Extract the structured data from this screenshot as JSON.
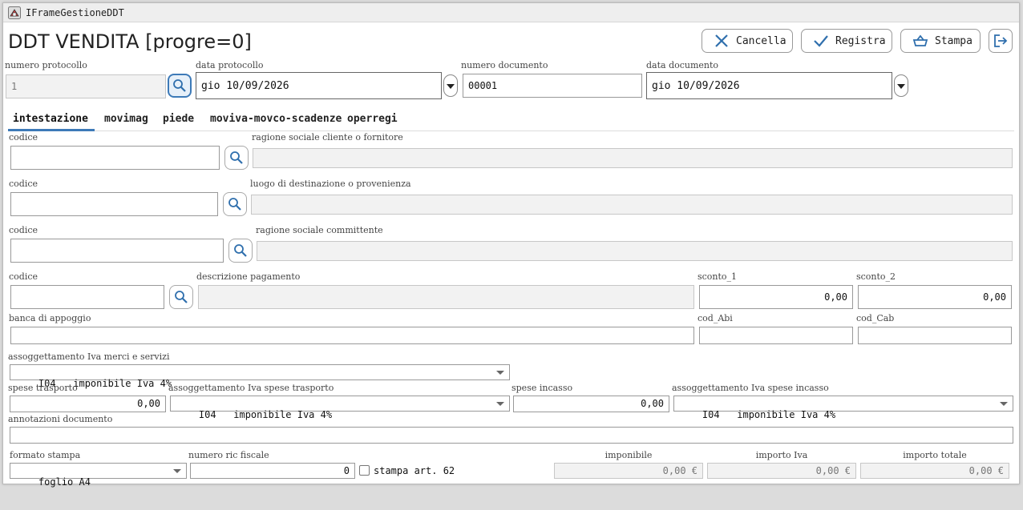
{
  "window": {
    "title": "IFrameGestioneDDT"
  },
  "heading": "DDT VENDITA [progre=0]",
  "toolbar": {
    "cancel_label": "Cancella",
    "save_label": "Registra",
    "print_label": "Stampa"
  },
  "header": {
    "protocol_number_label": "numero protocollo",
    "protocol_number_value": "1",
    "protocol_date_label": "data protocollo",
    "protocol_date_value": "gio 10/09/2026",
    "document_number_label": "numero documento",
    "document_number_value": "00001",
    "document_date_label": "data documento",
    "document_date_value": "gio 10/09/2026"
  },
  "tabs": [
    "intestazione",
    "movimag",
    "piede",
    "moviva-movco-scadenze",
    "operregi"
  ],
  "selected_tab": "intestazione",
  "form": {
    "customer": {
      "code_label": "codice",
      "code_value": "",
      "name_label": "ragione sociale cliente o fornitore",
      "name_value": ""
    },
    "destination": {
      "code_label": "codice",
      "code_value": "",
      "name_label": "luogo di destinazione o provenienza",
      "name_value": ""
    },
    "client": {
      "code_label": "codice",
      "code_value": "",
      "name_label": "ragione sociale committente",
      "name_value": ""
    },
    "payment": {
      "code_label": "codice",
      "code_value": "",
      "desc_label": "descrizione pagamento",
      "desc_value": ""
    },
    "discount1_label": "sconto_1",
    "discount1_value": "0,00",
    "discount2_label": "sconto_2",
    "discount2_value": "0,00",
    "bank_label": "banca di appoggio",
    "bank_value": "",
    "abi_label": "cod_Abi",
    "abi_value": "",
    "cab_label": "cod_Cab",
    "cab_value": "",
    "vat_goods_label": "assoggettamento Iva merci e servizi",
    "vat_goods_value": "I04   imponibile Iva 4%",
    "transport_label": "spese trasporto",
    "transport_value": "0,00",
    "vat_transport_label": "assoggettamento Iva spese trasporto",
    "vat_transport_value": "I04   imponibile Iva 4%",
    "collection_label": "spese incasso",
    "collection_value": "0,00",
    "vat_collection_label": "assoggettamento Iva spese incasso",
    "vat_collection_value": "I04   imponibile Iva 4%",
    "notes_label": "annotazioni documento",
    "notes_value": "",
    "print_format_label": "formato stampa",
    "print_format_value": "foglio A4",
    "fiscal_receipt_label": "numero ric fiscale",
    "fiscal_receipt_value": "0",
    "print_art62_label": "stampa art. 62",
    "taxable_label": "imponibile",
    "taxable_value": "0,00 €",
    "vat_amount_label": "importo Iva",
    "vat_amount_value": "0,00 €",
    "total_label": "importo totale",
    "total_value": "0,00 €"
  }
}
